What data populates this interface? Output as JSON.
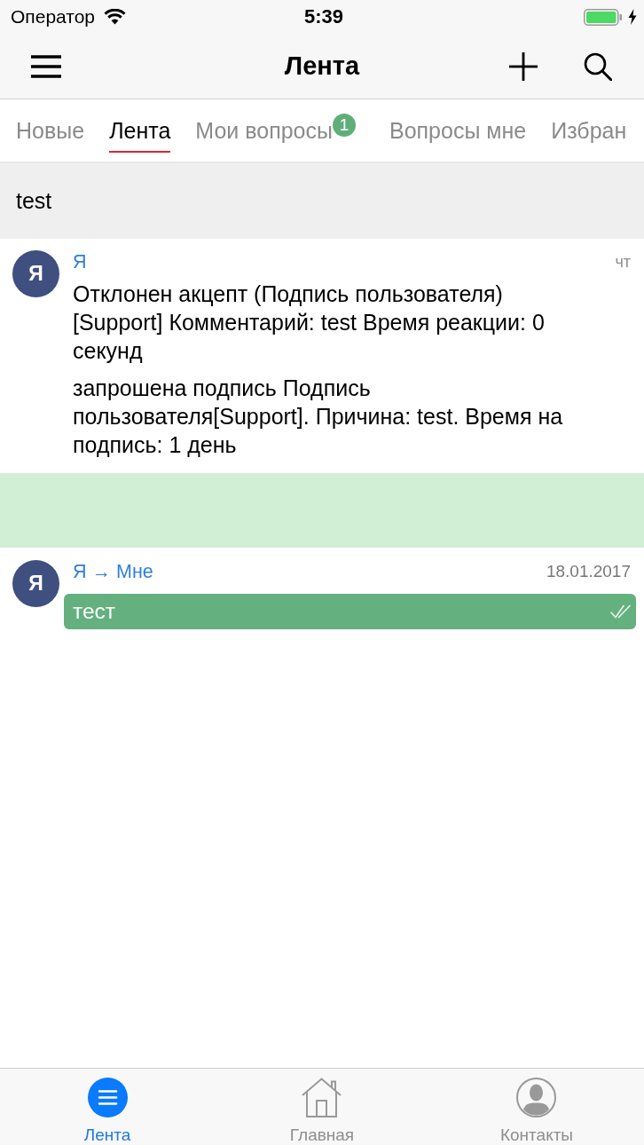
{
  "status_bar": {
    "carrier": "Оператор",
    "time": "5:39",
    "charging": true
  },
  "nav_bar": {
    "title": "Лента"
  },
  "tabs": [
    {
      "label": "Новые",
      "selected": false
    },
    {
      "label": "Лента",
      "selected": true
    },
    {
      "label": "Мои вопросы",
      "selected": false,
      "badge": "1"
    },
    {
      "label": "Вопросы мне",
      "selected": false
    },
    {
      "label": "Избран",
      "selected": false
    }
  ],
  "section": {
    "title": "test"
  },
  "feed": [
    {
      "kind": "event",
      "avatar": "Я",
      "author": "Я",
      "time": "чт",
      "paragraphs": [
        "Отклонен акцепт (Подпись пользователя) [Support] Комментарий: test Время реакции: 0 секунд",
        "запрошена подпись Подпись пользователя[Support]. Причина: test. Время на подпись: 1 день"
      ]
    },
    {
      "kind": "band"
    },
    {
      "kind": "message",
      "avatar": "Я",
      "author": "Я → Мне",
      "time": "18.01.2017",
      "text": "тест",
      "read": true
    }
  ],
  "tab_bar": [
    {
      "kind": "feed",
      "label": "Лента",
      "selected": true
    },
    {
      "kind": "home",
      "label": "Главная",
      "selected": false
    },
    {
      "kind": "contacts",
      "label": "Контакты",
      "selected": false
    }
  ]
}
